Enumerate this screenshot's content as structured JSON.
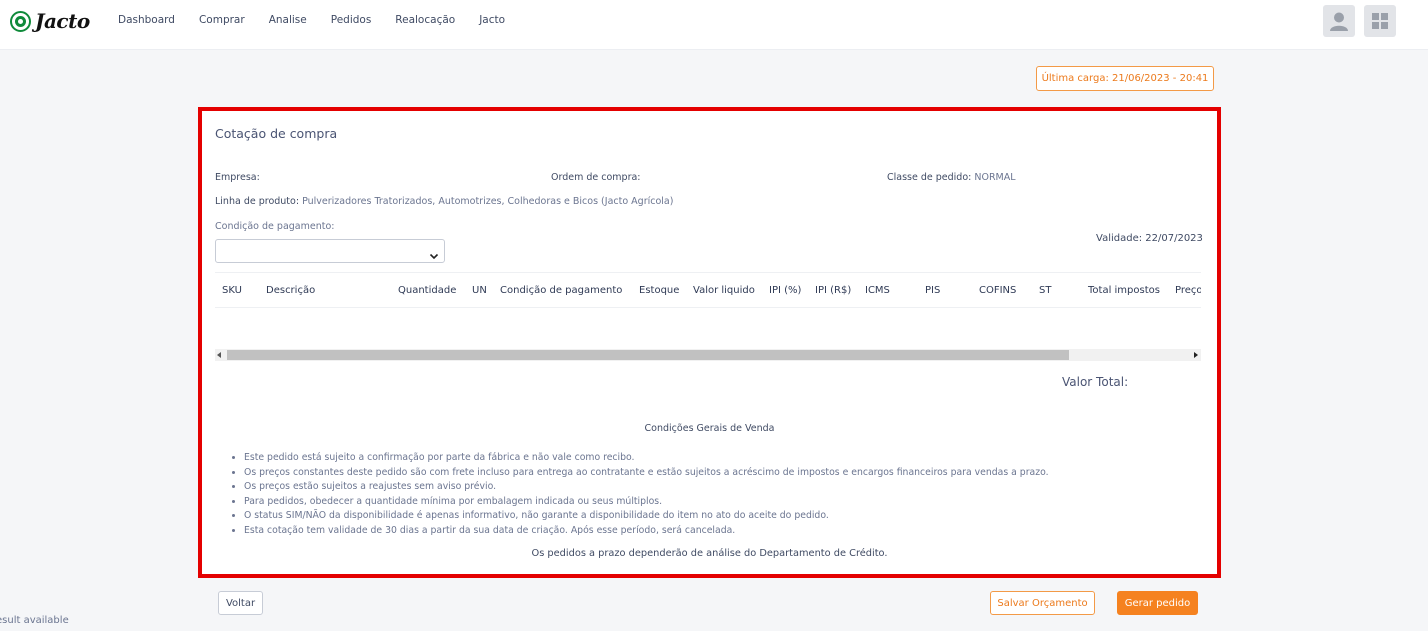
{
  "brand": {
    "name": "Jacto",
    "accent": "#0f8a3a"
  },
  "nav": [
    "Dashboard",
    "Comprar",
    "Analise",
    "Pedidos",
    "Realocação",
    "Jacto"
  ],
  "header_icons": [
    "user-icon",
    "apps-grid-icon"
  ],
  "ultima_carga": "Última carga: 21/06/2023 - 20:41",
  "card": {
    "title": "Cotação de compra",
    "empresa_label": "Empresa:",
    "empresa_value": "",
    "ordem_label": "Ordem de compra:",
    "ordem_value": "",
    "classe_label": "Classe de pedido:",
    "classe_value": "NORMAL",
    "linha_label": "Linha de produto:",
    "linha_value": "Pulverizadores Tratorizados, Automotrizes, Colhedoras e Bicos (Jacto Agrícola)",
    "condicao_label": "Condição de pagamento:",
    "condicao_selected": "",
    "validade": "Validade: 22/07/2023",
    "columns": [
      "SKU",
      "Descrição",
      "Quantidade",
      "UN",
      "Condição de pagamento",
      "Estoque",
      "Valor liquido",
      "IPI (%)",
      "IPI (R$)",
      "ICMS",
      "PIS",
      "COFINS",
      "ST",
      "Total impostos",
      "Preço"
    ],
    "valor_total": "Valor Total:",
    "condicoes_title": "Condições Gerais de Venda",
    "condicoes": [
      "Este pedido está sujeito a confirmação por parte da fábrica e não vale como recibo.",
      "Os preços constantes deste pedido são com frete incluso para entrega ao contratante e estão sujeitos a acréscimo de impostos e encargos financeiros para vendas a prazo.",
      "Os preços estão sujeitos a reajustes sem aviso prévio.",
      "Para pedidos, obedecer a quantidade mínima por embalagem indicada ou seus múltiplos.",
      "O status SIM/NÃO da disponibilidade é apenas informativo, não garante a disponibilidade do item no ato do aceite do pedido.",
      "Esta cotação tem validade de 30 dias a partir da sua data de criação. Após esse período, será cancelada."
    ],
    "credito_note": "Os pedidos a prazo dependerão de análise do Departamento de Crédito."
  },
  "buttons": {
    "voltar": "Voltar",
    "salvar": "Salvar Orçamento",
    "gerar": "Gerar pedido"
  },
  "footer_status": "esult available",
  "colors": {
    "orange": "#f58220",
    "highlight_border": "#e40000"
  }
}
